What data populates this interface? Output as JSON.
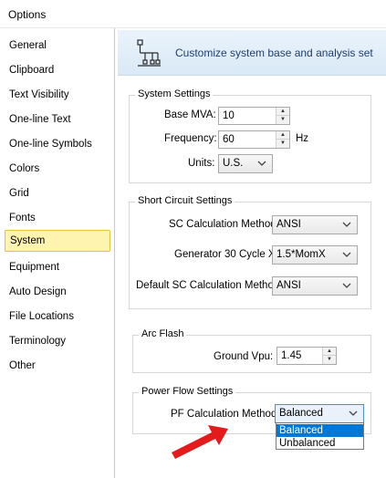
{
  "window": {
    "title": "Options"
  },
  "nav": {
    "items": [
      {
        "label": "General"
      },
      {
        "label": "Clipboard"
      },
      {
        "label": "Text Visibility"
      },
      {
        "label": "One-line Text"
      },
      {
        "label": "One-line Symbols"
      },
      {
        "label": "Colors"
      },
      {
        "label": "Grid"
      },
      {
        "label": "Fonts"
      },
      {
        "label": "System",
        "active": true
      },
      {
        "label": "Equipment"
      },
      {
        "label": "Auto Design"
      },
      {
        "label": "File Locations"
      },
      {
        "label": "Terminology"
      },
      {
        "label": "Other"
      }
    ]
  },
  "banner": {
    "text": "Customize system base and analysis set",
    "icon": "network-tree-icon"
  },
  "system_settings": {
    "legend": "System Settings",
    "base_mva_label": "Base MVA:",
    "base_mva_value": "10",
    "frequency_label": "Frequency:",
    "frequency_value": "60",
    "frequency_unit": "Hz",
    "units_label": "Units:",
    "units_value": "U.S."
  },
  "short_circuit": {
    "legend": "Short Circuit Settings",
    "method_label": "SC Calculation Method:",
    "method_value": "ANSI",
    "gen30_label": "Generator 30 Cycle X:",
    "gen30_value": "1.5*MomX",
    "default_label": "Default SC Calculation Method:",
    "default_value": "ANSI"
  },
  "arc_flash": {
    "legend": "Arc Flash",
    "ground_label": "Ground Vpu:",
    "ground_value": "1.45"
  },
  "power_flow": {
    "legend": "Power Flow Settings",
    "method_label": "PF Calculation Method:",
    "method_value": "Balanced",
    "options": [
      "Balanced",
      "Unbalanced"
    ],
    "highlighted_option": "Balanced"
  },
  "annotation": {
    "color": "#e31b1b",
    "icon": "red-arrow-icon"
  }
}
